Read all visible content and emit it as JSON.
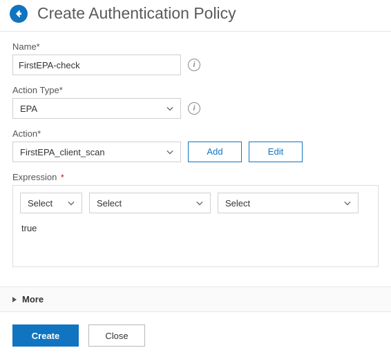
{
  "header": {
    "title": "Create Authentication Policy"
  },
  "fields": {
    "name": {
      "label": "Name*",
      "value": "FirstEPA-check"
    },
    "actionType": {
      "label": "Action Type*",
      "value": "EPA"
    },
    "action": {
      "label": "Action*",
      "value": "FirstEPA_client_scan",
      "add": "Add",
      "edit": "Edit"
    },
    "expression": {
      "label": "Expression",
      "sel1": "Select",
      "sel2": "Select",
      "sel3": "Select",
      "text": "true"
    }
  },
  "more": {
    "label": "More"
  },
  "footer": {
    "create": "Create",
    "close": "Close"
  }
}
